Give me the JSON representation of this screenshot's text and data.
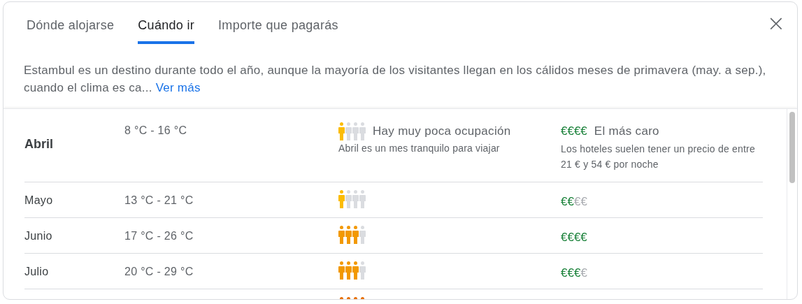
{
  "tabs": [
    {
      "label": "Dónde alojarse",
      "selected": false
    },
    {
      "label": "Cuándo ir",
      "selected": true
    },
    {
      "label": "Importe que pagarás",
      "selected": false
    }
  ],
  "close": "×",
  "description": {
    "text": "Estambul es un destino durante todo el año, aunque la mayoría de los visitantes llegan en los cálidos meses de primavera (may. a sep.), cuando el clima es ca...",
    "link": "Ver más"
  },
  "months": [
    {
      "month": "Abril",
      "temperature": "8 °C - 16 °C",
      "color": "#fbbc04",
      "crowd": [
        {
          "filled": true
        },
        {
          "filled": false
        },
        {
          "filled": false
        },
        {
          "filled": false
        }
      ],
      "crowd_title": "Hay muy poca ocupación",
      "crowd_note": "Abril es un mes tranquilo para viajar",
      "price_filled": "€€€€",
      "price_title": "El más caro",
      "price_note": "Los hoteles suelen tener un precio de entre 21 € y 54 € por noche",
      "expanded": true
    },
    {
      "month": "Mayo",
      "temperature": "13 °C - 21 °C",
      "color": "#fbbc04",
      "crowd": [
        {
          "filled": true
        },
        {
          "filled": false
        },
        {
          "filled": false
        },
        {
          "filled": false
        }
      ],
      "price_filled": "€€",
      "price_empty": "€€",
      "expanded": false
    },
    {
      "month": "Junio",
      "temperature": "17 °C - 26 °C",
      "color": "#f29900",
      "crowd": [
        {
          "filled": true
        },
        {
          "filled": true
        },
        {
          "filled": true
        },
        {
          "filled": false
        }
      ],
      "price_filled": "€€€€",
      "expanded": false
    },
    {
      "month": "Julio",
      "temperature": "20 °C - 29 °C",
      "color": "#f29900",
      "crowd": [
        {
          "filled": true
        },
        {
          "filled": true
        },
        {
          "filled": true
        },
        {
          "filled": false
        }
      ],
      "price_filled": "€€€",
      "price_empty": "€",
      "expanded": false
    },
    {
      "color": "#e8710a",
      "crowd": [
        {
          "filled": true
        },
        {
          "filled": true
        },
        {
          "filled": true
        },
        {
          "filled": true
        }
      ],
      "expanded": false
    }
  ]
}
